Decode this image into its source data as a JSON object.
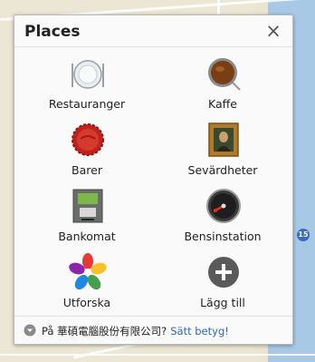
{
  "map": {
    "shield_number": "15"
  },
  "popup": {
    "title": "Places",
    "close_glyph": "×",
    "items": [
      {
        "label": "Restauranger",
        "icon": "plate-icon"
      },
      {
        "label": "Kaffe",
        "icon": "coffee-icon"
      },
      {
        "label": "Barer",
        "icon": "bottle-cap-icon"
      },
      {
        "label": "Sevärdheter",
        "icon": "painting-icon"
      },
      {
        "label": "Bankomat",
        "icon": "atm-icon"
      },
      {
        "label": "Bensinstation",
        "icon": "fuel-gauge-icon"
      },
      {
        "label": "Utforska",
        "icon": "flower-icon"
      },
      {
        "label": "Lägg till",
        "icon": "add-icon"
      }
    ],
    "footer": {
      "prefix": "På 華碩電腦股份有限公司?",
      "rate_link": "Sätt betyg!"
    }
  }
}
